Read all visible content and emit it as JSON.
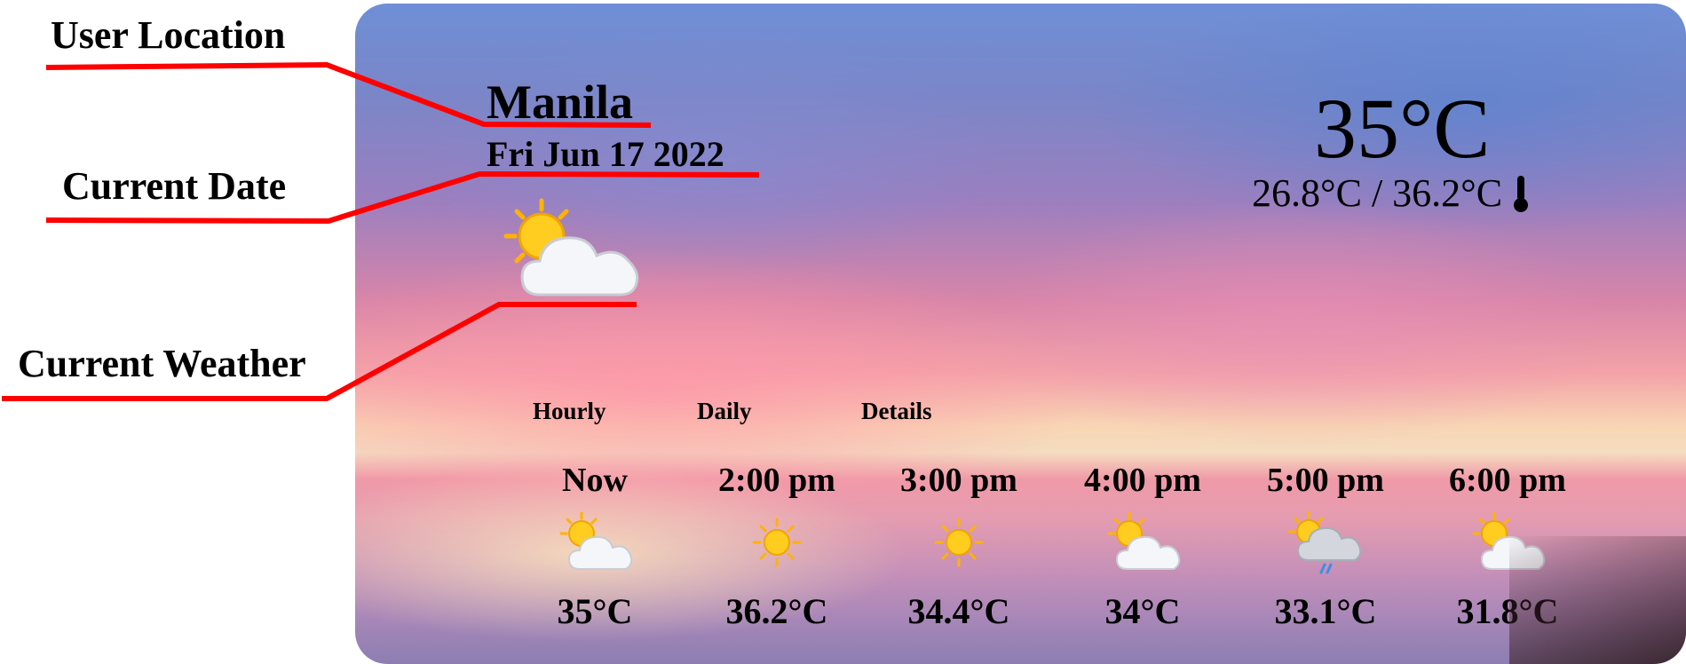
{
  "annotations": {
    "user_location": "User Location",
    "current_date": "Current Date",
    "current_weather": "Current Weather"
  },
  "location": {
    "city": "Manila",
    "date": "Fri Jun 17 2022"
  },
  "current": {
    "icon": "sun-behind-cloud-icon",
    "temp": "35°C",
    "minmax": "26.8°C / 36.2°C"
  },
  "tabs": [
    "Hourly",
    "Daily",
    "Details"
  ],
  "hourly": [
    {
      "time": "Now",
      "temp": "35°C",
      "icon": "sun-behind-cloud-icon"
    },
    {
      "time": "2:00 pm",
      "temp": "36.2°C",
      "icon": "sun-icon"
    },
    {
      "time": "3:00 pm",
      "temp": "34.4°C",
      "icon": "sun-icon"
    },
    {
      "time": "4:00 pm",
      "temp": "34°C",
      "icon": "sun-behind-cloud-icon"
    },
    {
      "time": "5:00 pm",
      "temp": "33.1°C",
      "icon": "sun-behind-rain-cloud-icon"
    },
    {
      "time": "6:00 pm",
      "temp": "31.8°C",
      "icon": "sun-behind-cloud-icon"
    }
  ],
  "colors": {
    "annotation_line": "#ff0000",
    "sun": "#ffcc1f",
    "cloud": "#f4f6fa"
  }
}
